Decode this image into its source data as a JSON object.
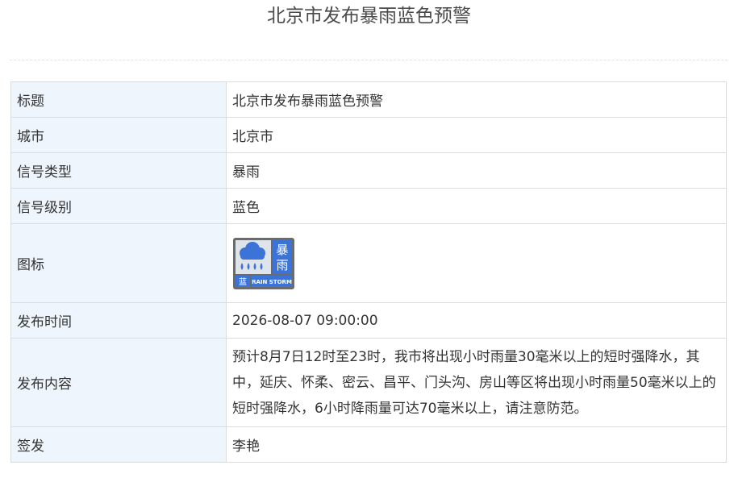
{
  "page": {
    "title": "北京市发布暴雨蓝色预警"
  },
  "rows": {
    "title": {
      "label": "标题",
      "value": "北京市发布暴雨蓝色预警"
    },
    "city": {
      "label": "城市",
      "value": "北京市"
    },
    "signal_type": {
      "label": "信号类型",
      "value": "暴雨"
    },
    "signal_level": {
      "label": "信号级别",
      "value": "蓝色"
    },
    "icon": {
      "label": "图标",
      "icon_name": "rainstorm-blue-warning-icon",
      "badge_text_top": "暴",
      "badge_text_bottom": "雨",
      "badge_level_char": "蓝",
      "badge_caption": "RAIN STORM",
      "colors": {
        "blue": "#3b74d6",
        "frame": "#6b6b6b",
        "panel": "#dfe3ea"
      }
    },
    "issue_time": {
      "label": "发布时间",
      "value": "2026-08-07 09:00:00"
    },
    "content": {
      "label": "发布内容",
      "value": "预计8月7日12时至23时，我市将出现小时雨量30毫米以上的短时强降水，其中，延庆、怀柔、密云、昌平、门头沟、房山等区将出现小时雨量50毫米以上的短时强降水，6小时降雨量可达70毫米以上，请注意防范。"
    },
    "signer": {
      "label": "签发",
      "value": "李艳"
    }
  }
}
